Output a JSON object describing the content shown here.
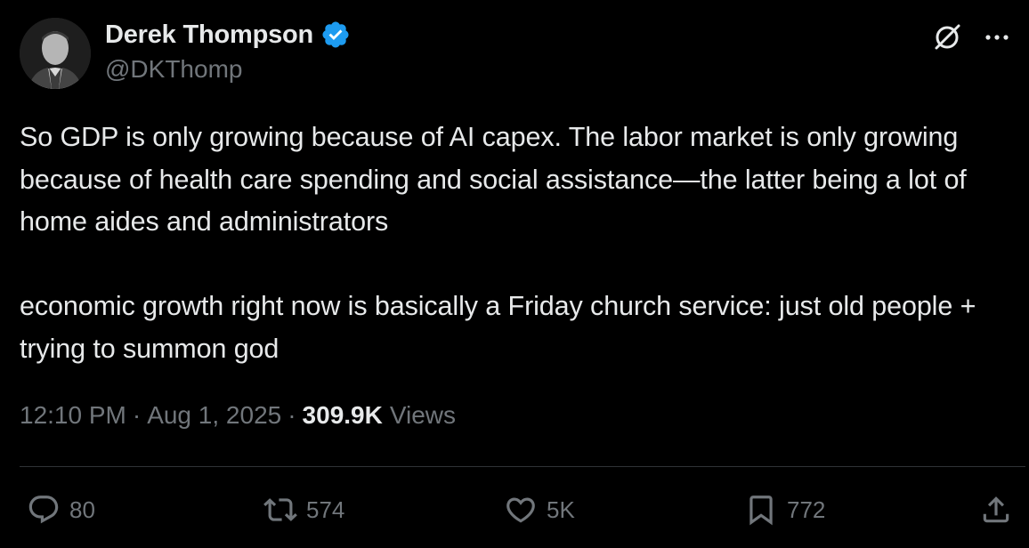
{
  "author": {
    "name": "Derek Thompson",
    "handle": "@DKThomp",
    "verified_color": "#1d9bf0"
  },
  "tweet": {
    "paragraphs": [
      "So GDP is only growing because of AI capex. The labor market is only growing because of health care spending and social assistance—the latter being a lot of home aides and administrators",
      "economic growth right now is basically a Friday church service: just old people + trying to summon god"
    ],
    "time": "12:10 PM",
    "separator": "·",
    "date": "Aug 1, 2025",
    "views_count": "309.9K",
    "views_label": "Views"
  },
  "actions": {
    "replies": "80",
    "reposts": "574",
    "likes": "5K",
    "bookmarks": "772"
  },
  "icons": {
    "top": [
      "grok-icon",
      "more-icon"
    ],
    "bar": [
      "reply-icon",
      "repost-icon",
      "like-icon",
      "bookmark-icon",
      "share-icon"
    ]
  },
  "colors": {
    "background": "#000000",
    "text": "#e7e9ea",
    "muted": "#71767b",
    "divider": "#2f3336"
  }
}
